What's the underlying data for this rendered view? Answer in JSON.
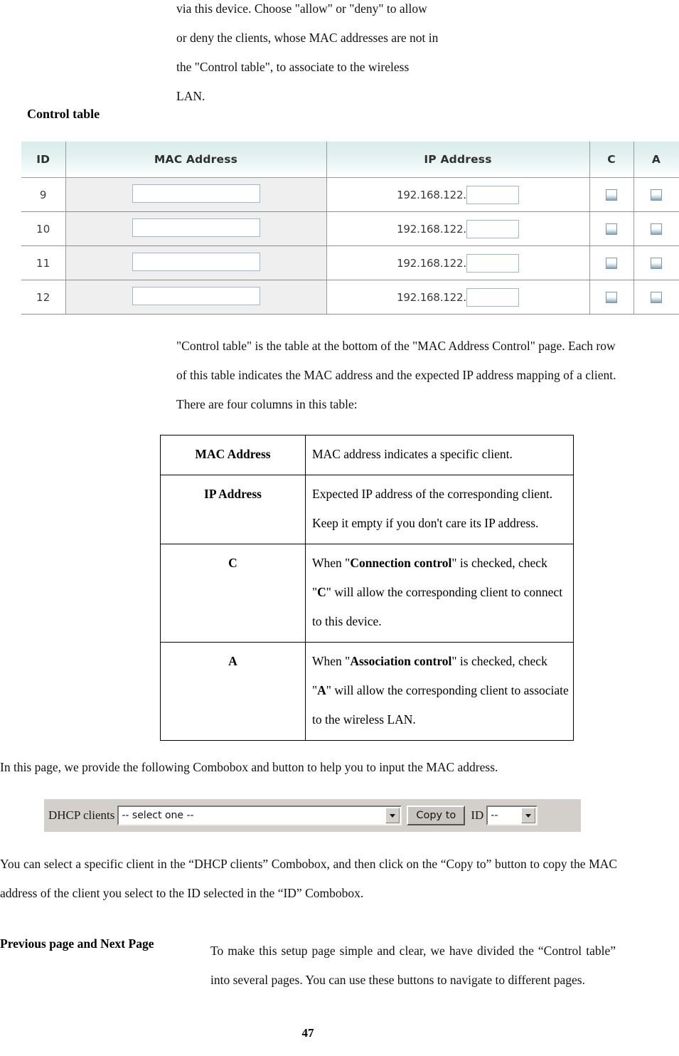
{
  "intro_paragraph": "via this device. Choose \"allow\" or \"deny\" to allow or deny the clients, whose MAC addresses are not in the \"Control table\", to associate to the wireless LAN.",
  "control_table_heading": "Control table",
  "mac_control_table": {
    "columns": [
      "ID",
      "MAC Address",
      "IP Address",
      "C",
      "A"
    ],
    "ip_prefix": "192.168.122.",
    "rows": [
      {
        "id": "9",
        "mac": "",
        "ip_suffix": "",
        "c_checked": false,
        "a_checked": false
      },
      {
        "id": "10",
        "mac": "",
        "ip_suffix": "",
        "c_checked": false,
        "a_checked": false
      },
      {
        "id": "11",
        "mac": "",
        "ip_suffix": "",
        "c_checked": false,
        "a_checked": false
      },
      {
        "id": "12",
        "mac": "",
        "ip_suffix": "",
        "c_checked": false,
        "a_checked": false
      }
    ],
    "colors": {
      "header_gradient_top": "#d8ecec",
      "header_gradient_bottom": "#ffffff",
      "mac_cell_background": "#efefef",
      "row_background": "#ffffff",
      "border": "#9a9a9a",
      "input_border": "#9cb7d4",
      "checkbox_border": "#7f97aa",
      "checkbox_gradient_bottom": "#7ea2b8"
    }
  },
  "control_table_description": "\"Control table\" is the table at the bottom of the \"MAC Address Control\" page. Each row of this table indicates the MAC address and the expected IP address mapping of a client. There are four columns in this table:",
  "definition_table": {
    "rows": [
      {
        "term": "MAC Address",
        "description": "MAC address indicates a specific client."
      },
      {
        "term": "IP Address",
        "description": "Expected IP address of the corresponding client. Keep it empty if you don't care its IP address."
      },
      {
        "term": "C",
        "description_parts": [
          {
            "text": "When \"",
            "bold": false
          },
          {
            "text": "Connection control",
            "bold": true
          },
          {
            "text": "\" is checked, check \"",
            "bold": false
          },
          {
            "text": "C",
            "bold": true
          },
          {
            "text": "\" will allow the corresponding client to connect to this device.",
            "bold": false
          }
        ]
      },
      {
        "term": "A",
        "description_parts": [
          {
            "text": "When \"",
            "bold": false
          },
          {
            "text": "Association control",
            "bold": true
          },
          {
            "text": "\" is checked, check \"",
            "bold": false
          },
          {
            "text": "A",
            "bold": true
          },
          {
            "text": "\" will allow the corresponding client to associate to the wireless LAN.",
            "bold": false
          }
        ]
      }
    ]
  },
  "combobox_intro": "In this page, we provide the following Combobox and button to help you to input the MAC address.",
  "dhcp_widget": {
    "label": "DHCP clients",
    "dhcp_selected_value": "-- select one --",
    "copy_to_label": "Copy to",
    "id_label": "ID",
    "id_selected_value": "--",
    "background_color": "#d3d0cb"
  },
  "select_explanation": "You can select a specific client in the “DHCP clients” Combobox, and then click on the “Copy to” button to copy the MAC address of the client you select to the ID selected in the “ID” Combobox.",
  "prevnext": {
    "label": "Previous page and Next Page",
    "body": "To make this setup page simple and clear, we have divided the “Control table” into several pages. You can use these buttons to navigate to different pages."
  },
  "page_number": "47"
}
